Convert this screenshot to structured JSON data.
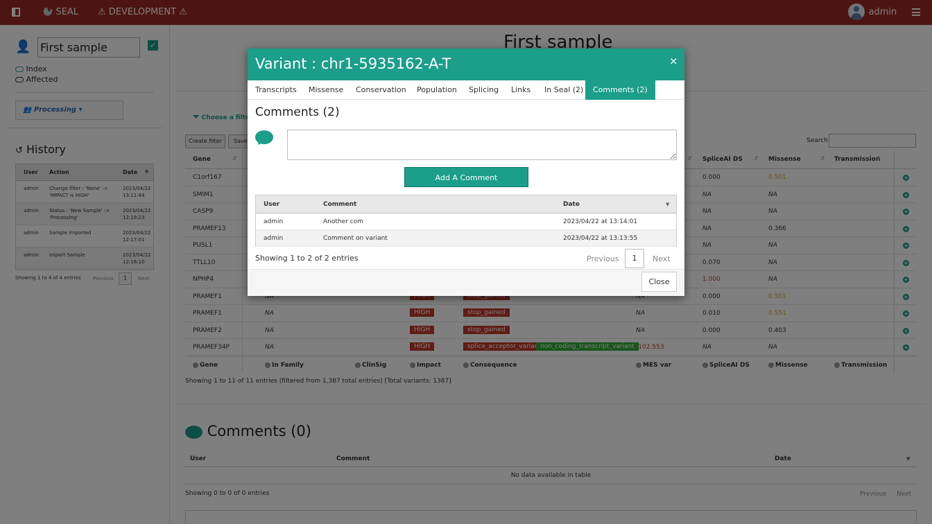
{
  "navbar": {
    "brand": "SEAL",
    "env": "DEVELOPMENT",
    "user": "admin"
  },
  "sidebar": {
    "sample_name": "First sample",
    "index_label": "Index",
    "affected_label": "Affected",
    "status_button": "Processing",
    "history_title": "History",
    "history_headers": [
      "User",
      "Action",
      "Date"
    ],
    "history_rows": [
      {
        "user": "admin",
        "action1": "Change filter : 'None' ->",
        "action2": "'IMPACT is HIGH'",
        "date1": "2023/04/22",
        "date2": "13:11:44"
      },
      {
        "user": "admin",
        "action1": "Status : 'New Sample' ->",
        "action2": "'Processing'",
        "date1": "2023/04/22",
        "date2": "12:19:23"
      },
      {
        "user": "admin",
        "action1": "Sample Imported",
        "action2": "",
        "date1": "2023/04/22",
        "date2": "12:17:01"
      },
      {
        "user": "admin",
        "action1": "Import Sample",
        "action2": "",
        "date1": "2023/04/22",
        "date2": "12:16:10"
      }
    ],
    "history_info": "Showing 1 to 4 of 4 entries",
    "pag_prev": "Previous",
    "pag_page": "1",
    "pag_next": "Next"
  },
  "content": {
    "page_title": "First sample",
    "choose_filter": "Choose a filter",
    "create_filter": "Create filter",
    "save_filter": "Save fi",
    "search_label": "Search:",
    "variant_headers": {
      "gene": "Gene",
      "splice": "SpliceAI DS",
      "missense": "Missense",
      "transmission": "Transmission"
    },
    "variant_rows": [
      {
        "gene": "C1orf167",
        "infam": "",
        "impact": "",
        "cons1": "",
        "cons2": "",
        "mes": "",
        "splice": "0.000",
        "missense": "0.501",
        "missense_color": "#e0a020"
      },
      {
        "gene": "SMIM1",
        "infam": "",
        "impact": "",
        "cons1": "",
        "cons2": "",
        "mes": "",
        "splice": "NA",
        "missense": "NA",
        "missense_color": "#333"
      },
      {
        "gene": "CASP9",
        "infam": "",
        "impact": "",
        "cons1": "",
        "cons2": "",
        "mes": "",
        "splice": "NA",
        "missense": "NA",
        "missense_color": "#333"
      },
      {
        "gene": "PRAMEF13",
        "infam": "",
        "impact": "",
        "cons1": "",
        "cons2": "",
        "mes": "",
        "splice": "NA",
        "missense": "0.366",
        "missense_color": "#333"
      },
      {
        "gene": "PUSL1",
        "infam": "",
        "impact": "",
        "cons1": "",
        "cons2": "",
        "mes": "",
        "splice": "NA",
        "missense": "NA",
        "missense_color": "#333"
      },
      {
        "gene": "TTLL10",
        "infam": "",
        "impact": "",
        "cons1": "",
        "cons2": "",
        "mes": "",
        "splice": "0.070",
        "missense": "NA",
        "missense_color": "#333"
      },
      {
        "gene": "NPHP4",
        "infam": "",
        "impact": "",
        "cons1": "",
        "cons2": "",
        "mes": "",
        "splice": "1.000",
        "missense": "NA",
        "missense_color": "#333"
      },
      {
        "gene": "PRAMEF1",
        "infam": "NA",
        "impact": "HIGH",
        "cons1": "stop_gained",
        "cons2": "",
        "mes": "NA",
        "splice": "0.000",
        "missense": "0.501",
        "missense_color": "#e0a020"
      },
      {
        "gene": "PRAMEF1",
        "infam": "NA",
        "impact": "HIGH",
        "cons1": "stop_gained",
        "cons2": "",
        "mes": "NA",
        "splice": "0.010",
        "missense": "0.551",
        "missense_color": "#e0a020"
      },
      {
        "gene": "PRAMEF2",
        "infam": "NA",
        "impact": "HIGH",
        "cons1": "stop_gained",
        "cons2": "",
        "mes": "NA",
        "splice": "0.000",
        "missense": "0.403",
        "missense_color": "#333"
      },
      {
        "gene": "PRAMEF34P",
        "infam": "NA",
        "impact": "HIGH",
        "cons1": "splice_acceptor_variant",
        "cons2": "non_coding_transcript_variant",
        "mes": "-102.553",
        "splice": "NA",
        "missense": "NA",
        "missense_color": "#333"
      }
    ],
    "footer_headers": [
      "Gene",
      "In Family",
      "ClinSig",
      "Impact",
      "Consequence",
      "MES var",
      "SpliceAI DS",
      "Missense",
      "Transmission"
    ],
    "variants_info": "Showing 1 to 11 of 11 entries (filtered from 1,387 total entries) [Total variants: 1387]",
    "comments_title": "Comments (0)",
    "comments_headers": [
      "User",
      "Comment",
      "Date"
    ],
    "comments_empty": "No data available in table",
    "comments_info": "Showing 0 to 0 of 0 entries",
    "pag_prev": "Previous",
    "pag_next": "Next"
  },
  "modal": {
    "title": "Variant : chr1-5935162-A-T",
    "close_x": "×",
    "tabs": [
      "Transcripts",
      "Missense",
      "Conservation",
      "Population",
      "Splicing",
      "Links",
      "In Seal (2)",
      "Comments (2)"
    ],
    "section_title": "Comments (2)",
    "textarea_value": "",
    "add_button": "Add A Comment",
    "headers": [
      "User",
      "Comment",
      "Date"
    ],
    "rows": [
      {
        "user": "admin",
        "comment": "Another com",
        "date": "2023/04/22 at 13:14:01"
      },
      {
        "user": "admin",
        "comment": "Comment on variant",
        "date": "2023/04/22 at 13:13:55"
      }
    ],
    "info": "Showing 1 to 2 of 2 entries",
    "pag_prev": "Previous",
    "pag_page": "1",
    "pag_next": "Next",
    "close_button": "Close"
  },
  "colors": {
    "navbar": "#9b2a22",
    "accent": "#1b9e8a",
    "high": "#c0392b",
    "green_badge": "#2eab36",
    "red_value": "#c0392b"
  }
}
